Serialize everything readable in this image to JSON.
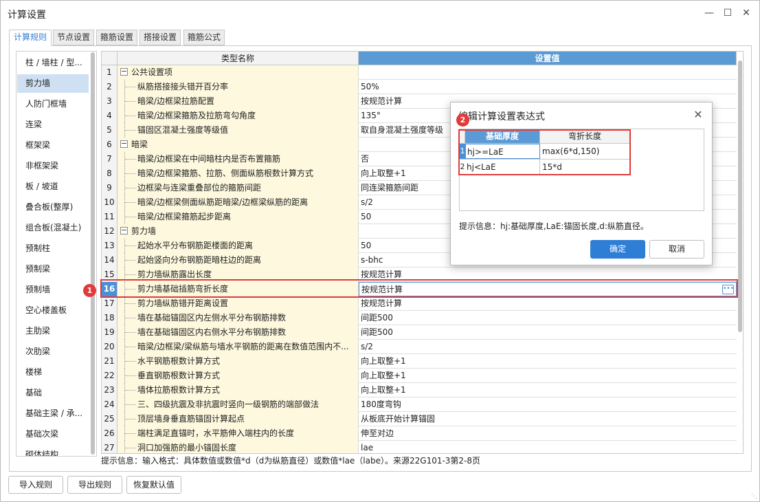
{
  "window": {
    "title": "计算设置"
  },
  "tabs": [
    {
      "label": "计算规则",
      "active": true
    },
    {
      "label": "节点设置",
      "active": false
    },
    {
      "label": "箍筋设置",
      "active": false
    },
    {
      "label": "搭接设置",
      "active": false
    },
    {
      "label": "箍筋公式",
      "active": false
    }
  ],
  "sidebar": {
    "selected_index": 1,
    "items": [
      {
        "label": "柱 / 墙柱 / 型..."
      },
      {
        "label": "剪力墙"
      },
      {
        "label": "人防门框墙"
      },
      {
        "label": "连梁"
      },
      {
        "label": "框架梁"
      },
      {
        "label": "非框架梁"
      },
      {
        "label": "板 / 坡道"
      },
      {
        "label": "叠合板(整厚)"
      },
      {
        "label": "组合板(混凝土)"
      },
      {
        "label": "预制柱"
      },
      {
        "label": "预制梁"
      },
      {
        "label": "预制墙"
      },
      {
        "label": "空心楼盖板"
      },
      {
        "label": "主肋梁"
      },
      {
        "label": "次肋梁"
      },
      {
        "label": "楼梯"
      },
      {
        "label": "基础"
      },
      {
        "label": "基础主梁 / 承..."
      },
      {
        "label": "基础次梁"
      },
      {
        "label": "砌体结构"
      }
    ]
  },
  "grid": {
    "headers": {
      "name": "类型名称",
      "value": "设置值"
    },
    "selected_row": 16,
    "rows": [
      {
        "num": "1",
        "name": "公共设置项",
        "value": "",
        "group": true
      },
      {
        "num": "2",
        "name": "纵筋搭接接头错开百分率",
        "value": "50%"
      },
      {
        "num": "3",
        "name": "暗梁/边框梁拉筋配置",
        "value": "按规范计算"
      },
      {
        "num": "4",
        "name": "暗梁/边框梁箍筋及拉筋弯勾角度",
        "value": "135°"
      },
      {
        "num": "5",
        "name": "锚固区混凝土强度等级值",
        "value": "取自身混凝土强度等级"
      },
      {
        "num": "6",
        "name": "暗梁",
        "value": "",
        "group": true
      },
      {
        "num": "7",
        "name": "暗梁/边框梁在中间暗柱内是否布置箍筋",
        "value": "否"
      },
      {
        "num": "8",
        "name": "暗梁/边框梁箍筋、拉筋、侧面纵筋根数计算方式",
        "value": "向上取整+1"
      },
      {
        "num": "9",
        "name": "边框梁与连梁重叠部位的箍筋间距",
        "value": "同连梁箍筋间距"
      },
      {
        "num": "10",
        "name": "暗梁/边框梁侧面纵筋距暗梁/边框梁纵筋的距离",
        "value": "s/2"
      },
      {
        "num": "11",
        "name": "暗梁/边框梁箍筋起步距离",
        "value": "50"
      },
      {
        "num": "12",
        "name": "剪力墙",
        "value": "",
        "group": true
      },
      {
        "num": "13",
        "name": "起始水平分布钢筋距楼面的距离",
        "value": "50"
      },
      {
        "num": "14",
        "name": "起始竖向分布钢筋距暗柱边的距离",
        "value": "s-bhc"
      },
      {
        "num": "15",
        "name": "剪力墙纵筋露出长度",
        "value": "按规范计算"
      },
      {
        "num": "16",
        "name": "剪力墙基础插筋弯折长度",
        "value": "按规范计算"
      },
      {
        "num": "17",
        "name": "剪力墙纵筋错开距离设置",
        "value": "按规范计算"
      },
      {
        "num": "18",
        "name": "墙在基础锚固区内左侧水平分布钢筋排数",
        "value": "间距500"
      },
      {
        "num": "19",
        "name": "墙在基础锚固区内右侧水平分布钢筋排数",
        "value": "间距500"
      },
      {
        "num": "20",
        "name": "暗梁/边框梁/梁纵筋与墙水平钢筋的距离在数值范围内不...",
        "value": "s/2"
      },
      {
        "num": "21",
        "name": "水平钢筋根数计算方式",
        "value": "向上取整+1"
      },
      {
        "num": "22",
        "name": "垂直钢筋根数计算方式",
        "value": "向上取整+1"
      },
      {
        "num": "23",
        "name": "墙体拉筋根数计算方式",
        "value": "向上取整+1"
      },
      {
        "num": "24",
        "name": "三、四级抗震及非抗震时竖向一级钢筋的端部做法",
        "value": "180度弯钩"
      },
      {
        "num": "25",
        "name": "顶层墙身垂直筋锚固计算起点",
        "value": "从板底开始计算锚固"
      },
      {
        "num": "26",
        "name": "端柱满足直锚时，水平筋伸入端柱内的长度",
        "value": "伸至对边"
      },
      {
        "num": "27",
        "name": "洞口加强筋的最小锚固长度",
        "value": "lae"
      }
    ]
  },
  "hint": "提示信息：输入格式：具体数值或数值*d（d为纵筋直径）或数值*lae（labe）。来源22G101-3第2-8页",
  "buttons": {
    "import": "导入规则",
    "export": "导出规则",
    "restore": "恢复默认值"
  },
  "badges": {
    "one": "1",
    "two": "2"
  },
  "dialog": {
    "title": "编辑计算设置表达式",
    "headers": {
      "thickness": "基础厚度",
      "bend": "弯折长度"
    },
    "rows": [
      {
        "num": "1",
        "condition": "hj>=LaE",
        "value": "max(6*d,150)"
      },
      {
        "num": "2",
        "condition": "hj<LaE",
        "value": "15*d"
      }
    ],
    "hint": "提示信息：hj:基础厚度,LaE:锚固长度,d:纵筋直径。",
    "ok": "确定",
    "cancel": "取消"
  },
  "colors": {
    "accent": "#2e7ed6",
    "highlight": "#e03a3a",
    "header_blue": "#5b9bd5",
    "name_bg": "#fdf8de"
  }
}
